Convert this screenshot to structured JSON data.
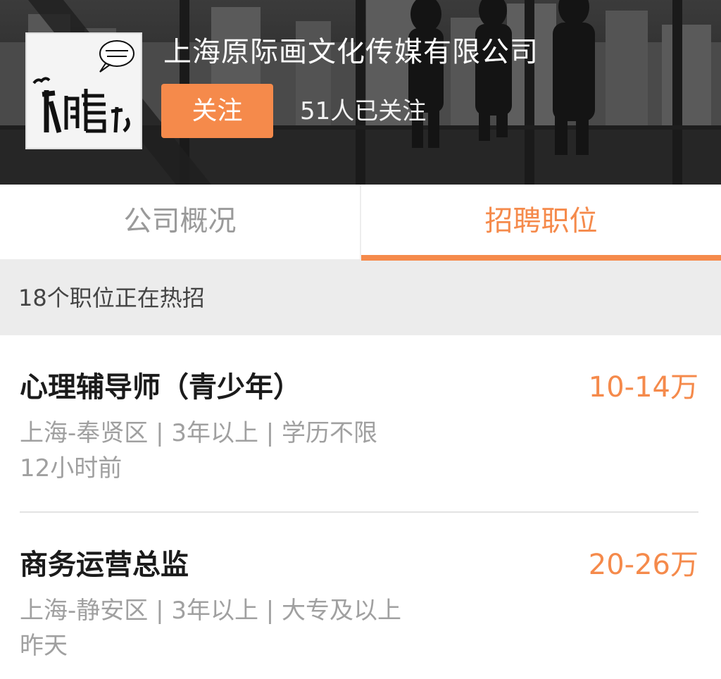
{
  "company": {
    "name": "上海原际画文化传媒有限公司",
    "follow_label": "关注",
    "followers_text": "51人已关注",
    "logo_text": "原際畫"
  },
  "tabs": [
    {
      "label": "公司概况",
      "active": false
    },
    {
      "label": "招聘职位",
      "active": true
    }
  ],
  "section": {
    "header": "18个职位正在热招"
  },
  "jobs": [
    {
      "title": "心理辅导师（青少年）",
      "salary": "10-14万",
      "meta": "上海-奉贤区 | 3年以上 | 学历不限",
      "time": "12小时前"
    },
    {
      "title": "商务运营总监",
      "salary": "20-26万",
      "meta": "上海-静安区 | 3年以上 | 大专及以上",
      "time": "昨天"
    }
  ],
  "colors": {
    "accent": "#f58a4b",
    "muted": "#a0a0a0",
    "section_bg": "#ececec"
  }
}
